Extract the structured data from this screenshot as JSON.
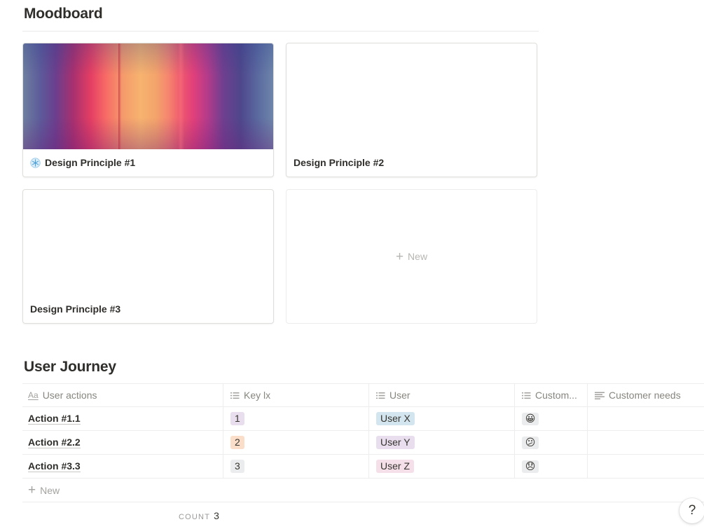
{
  "moodboard": {
    "title": "Moodboard",
    "cards": [
      {
        "title": "Design Principle #1",
        "icon": "snowflake-icon"
      },
      {
        "title": "Design Principle #2"
      },
      {
        "title": "Design Principle #3"
      }
    ],
    "new_label": "New"
  },
  "journey": {
    "title": "User Journey",
    "columns": [
      "User actions",
      "Key lx",
      "User",
      "Custom...",
      "Customer needs"
    ],
    "rows": [
      {
        "action": "Action #1.1",
        "key": "1",
        "user": "User X",
        "emoji": "😀"
      },
      {
        "action": "Action #2.2",
        "key": "2",
        "user": "User Y",
        "emoji": "😕"
      },
      {
        "action": "Action #3.3",
        "key": "3",
        "user": "User Z",
        "emoji": "😞"
      }
    ],
    "new_label": "New",
    "count_label": "COUNT",
    "count_value": "3"
  },
  "help_label": "?"
}
